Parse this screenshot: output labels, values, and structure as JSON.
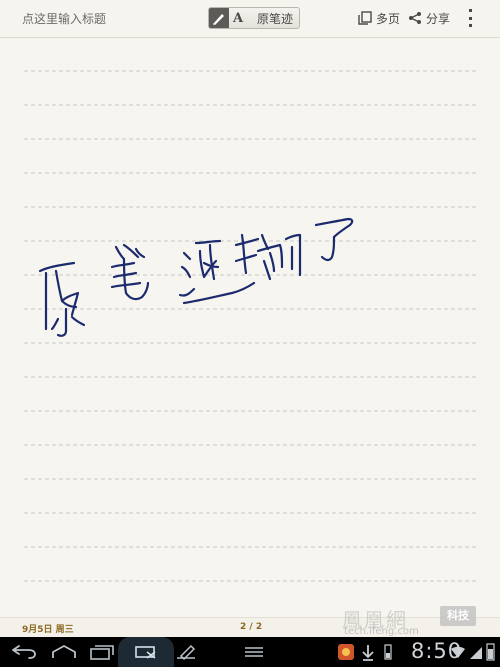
{
  "header": {
    "title_placeholder": "点这里输入标题",
    "mode_text_glyph": "A",
    "mode_label": "原笔迹",
    "pages_label": "多页",
    "share_label": "分享"
  },
  "footer": {
    "date": "9月5日 周三",
    "page_indicator": "2 / 2"
  },
  "watermark": {
    "brand": "鳳凰網",
    "tag": "科技",
    "url": "tech.ifeng.com"
  },
  "system_bar": {
    "clock": "8:50"
  },
  "colors": {
    "ink": "#1c2a6e",
    "ruled_line": "#c9c7bf",
    "footer_text": "#8a6a22",
    "paper": "#f6f5f0"
  },
  "icons": {
    "pages": "pages-icon",
    "share": "share-icon",
    "more": "overflow-menu-icon",
    "pen_mode": "handwriting-pen-icon",
    "back": "back-icon",
    "home": "home-icon",
    "recent": "recent-apps-icon",
    "screenshot": "screenshot-icon",
    "edit": "edit-icon",
    "menu": "menu-icon"
  }
}
